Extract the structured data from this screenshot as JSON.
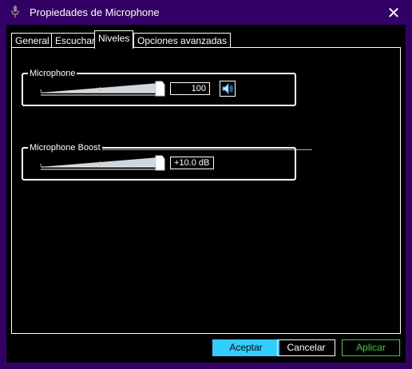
{
  "window": {
    "title": "Propiedades de Microphone"
  },
  "tabs": [
    {
      "label": "General"
    },
    {
      "label": "Escuchar"
    },
    {
      "label": "Niveles"
    },
    {
      "label": "Opciones avanzadas"
    }
  ],
  "active_tab": "Niveles",
  "microphone": {
    "label": "Microphone",
    "value": "100",
    "level": 1.0
  },
  "boost": {
    "label": "Microphone Boost",
    "value": "+10.0 dB",
    "level": 1.0
  },
  "buttons": {
    "ok": "Aceptar",
    "cancel": "Cancelar",
    "apply": "Aplicar"
  },
  "colors": {
    "titlebar": "#330066",
    "ok_border": "#33ccff",
    "apply_text": "#33cc33",
    "speaker_icon": "#3399ff"
  },
  "icons": {
    "title": "microphone-icon",
    "close": "close-icon",
    "speaker": "speaker-icon"
  }
}
